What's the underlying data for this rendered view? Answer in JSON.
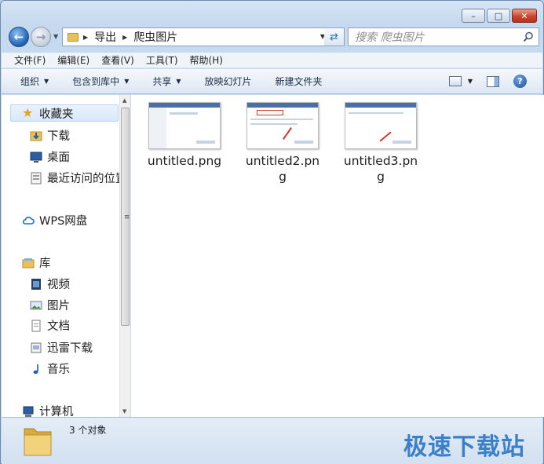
{
  "window": {
    "caption_minimize": "–",
    "caption_maximize": "□",
    "caption_close": "✕"
  },
  "address": {
    "crumbs": [
      "导出",
      "爬虫图片"
    ],
    "search_placeholder": "搜索 爬虫图片"
  },
  "menu": [
    "文件(F)",
    "编辑(E)",
    "查看(V)",
    "工具(T)",
    "帮助(H)"
  ],
  "toolbar": {
    "organize": "组织",
    "include_in_library": "包含到库中",
    "share": "共享",
    "slideshow": "放映幻灯片",
    "new_folder": "新建文件夹"
  },
  "nav": {
    "favorites": "收藏夹",
    "downloads": "下载",
    "desktop": "桌面",
    "recent": "最近访问的位置",
    "wps": "WPS网盘",
    "libraries": "库",
    "videos": "视频",
    "pictures": "图片",
    "documents": "文档",
    "thunder": "迅雷下载",
    "music": "音乐",
    "computer": "计算机"
  },
  "files": [
    {
      "name": "untitled.png"
    },
    {
      "name": "untitled2.png"
    },
    {
      "name": "untitled3.png"
    }
  ],
  "status": {
    "count_text": "3 个对象"
  },
  "watermark": "极速下载站",
  "colors": {
    "accent": "#3c7fc9",
    "frame": "#c5d9ef",
    "selection": "#d8e8fb"
  }
}
